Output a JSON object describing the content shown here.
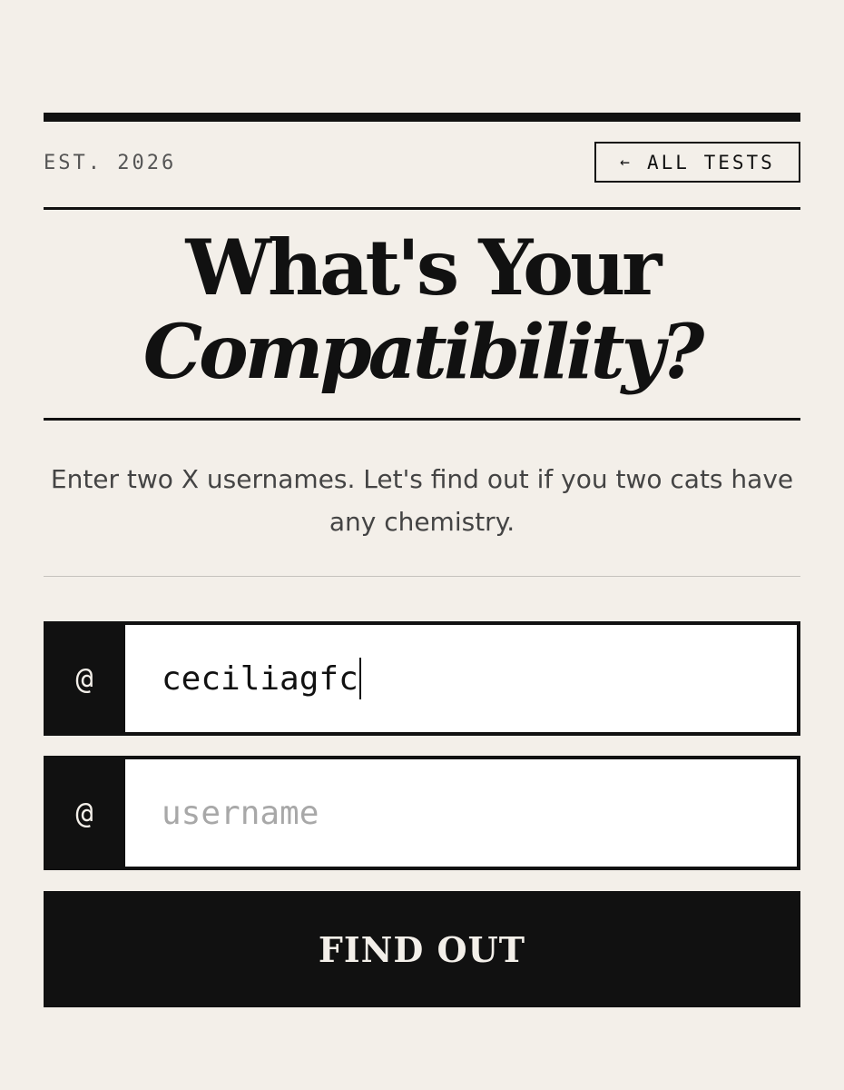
{
  "header": {
    "established": "EST. 2026",
    "back_button": {
      "arrow": "←",
      "label": "ALL TESTS"
    }
  },
  "title": {
    "line1": "What's Your",
    "line2": "Compatibility?"
  },
  "subtitle": "Enter two X usernames. Let's find out if you two cats have any chemistry.",
  "form": {
    "field1": {
      "prefix": "@",
      "value": "ceciliagfc",
      "placeholder": "username"
    },
    "field2": {
      "prefix": "@",
      "value": "",
      "placeholder": "username"
    },
    "submit_label": "FIND OUT"
  },
  "colors": {
    "background": "#f3efe9",
    "ink": "#111111",
    "muted": "#555555",
    "placeholder": "#a8a8a8"
  }
}
